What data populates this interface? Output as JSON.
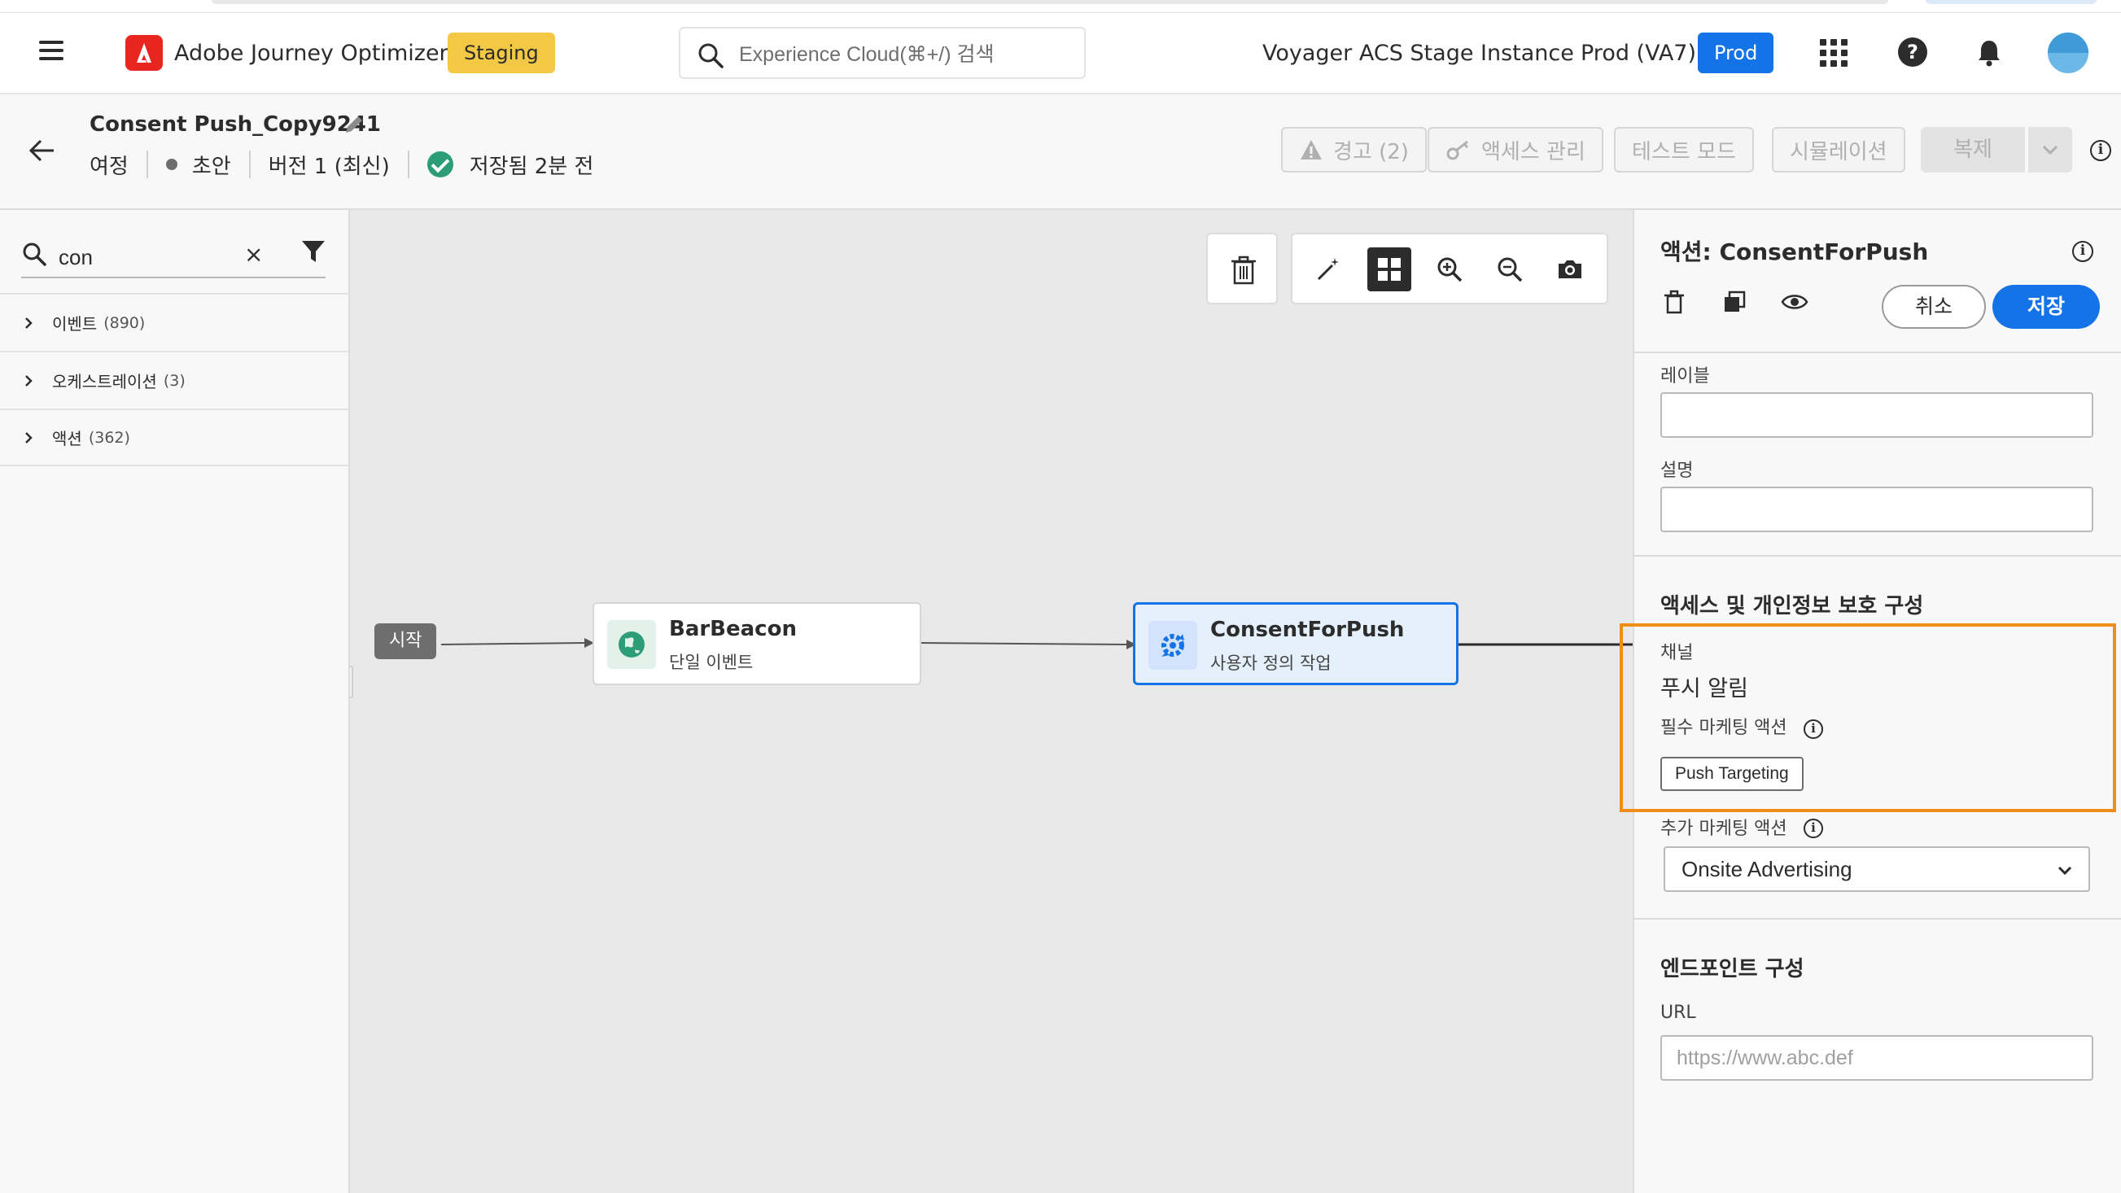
{
  "app": {
    "name": "Adobe Journey Optimizer",
    "environment_badge": "Staging",
    "search_placeholder": "Experience Cloud(⌘+/) 검색",
    "org_name": "Voyager ACS Stage Instance",
    "sandbox_name": "Prod (VA7)",
    "sandbox_badge": "Prod",
    "icons": [
      "hamburger-icon",
      "adobe-logo",
      "search-icon",
      "apps-grid-icon",
      "help-icon",
      "bell-icon",
      "avatar"
    ]
  },
  "journey": {
    "name": "Consent Push_Copy9241",
    "type": "여정",
    "status": "초안",
    "version": "버전 1 (최신)",
    "saved": "저장됨 2분 전",
    "buttons": {
      "warnings": "경고 (2)",
      "access": "액세스 관리",
      "test_mode": "테스트 모드",
      "simulation": "시뮬레이션",
      "duplicate": "복제"
    }
  },
  "left_panel": {
    "search_value": "con",
    "categories": [
      {
        "label": "이벤트",
        "count": "(890)"
      },
      {
        "label": "오케스트레이션",
        "count": "(3)"
      },
      {
        "label": "액션",
        "count": "(362)"
      }
    ]
  },
  "canvas": {
    "start_label": "시작",
    "nodes": [
      {
        "title": "BarBeacon",
        "subtitle": "단일 이벤트"
      },
      {
        "title": "ConsentForPush",
        "subtitle": "사용자 정의 작업"
      }
    ]
  },
  "right_panel": {
    "title": "액션: ConsentForPush",
    "cancel": "취소",
    "save": "저장",
    "label_field": {
      "label": "레이블",
      "value": ""
    },
    "description_field": {
      "label": "설명",
      "value": ""
    },
    "privacy_section": {
      "title": "액세스 및 개인정보 보호 구성",
      "channel_label": "채널",
      "channel_value": "푸시 알림",
      "required_label": "필수 마케팅 액션",
      "required_tag": "Push Targeting",
      "additional_label": "추가 마케팅 액션",
      "additional_value": "Onsite Advertising"
    },
    "endpoint_section": {
      "title": "엔드포인트 구성",
      "url_label": "URL",
      "url_placeholder": "https://www.abc.def"
    }
  },
  "colors": {
    "accent": "#1473e6",
    "staging": "#f2c844",
    "highlight": "#f08c1a",
    "saved_check": "#2d9d78"
  }
}
